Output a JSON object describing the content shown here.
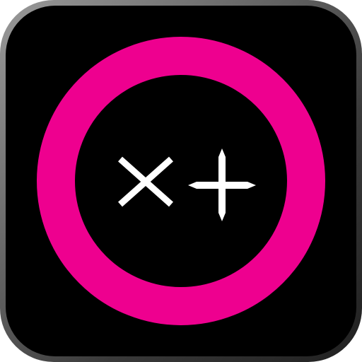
{
  "app_icon": {
    "name": "calculator-app-icon",
    "colors": {
      "background": "#000000",
      "ring": "#ee008f",
      "symbols": "#ffffff",
      "frame": "#7a7a7a"
    },
    "symbols": [
      "multiply-icon",
      "plus-icon"
    ]
  }
}
